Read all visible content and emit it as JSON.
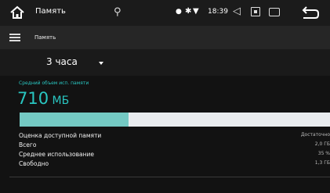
{
  "status_bar": {
    "title": "Память",
    "time": "18:39",
    "icons": [
      "home-icon",
      "usb-icon",
      "location-icon",
      "bluetooth-icon",
      "wifi-icon",
      "volume-icon",
      "screen-icon",
      "window-icon",
      "back-icon"
    ]
  },
  "app_bar": {
    "title": "Память"
  },
  "period": {
    "selected": "3 часа"
  },
  "summary": {
    "label": "Средний объем исп. памяти",
    "value": "710",
    "unit": "МБ",
    "usage_fraction": 0.35,
    "accent_color": "#29c6c1",
    "bar_fill_color": "#74c9c3",
    "bar_track_color": "#e9ecef"
  },
  "stats": [
    {
      "label": "Оценка доступной памяти",
      "value": "Достаточно"
    },
    {
      "label": "Всего",
      "value": "2,0 ГБ"
    },
    {
      "label": "Среднее использование",
      "value": "35 %"
    },
    {
      "label": "Свободно",
      "value": "1,3 ГБ"
    }
  ]
}
